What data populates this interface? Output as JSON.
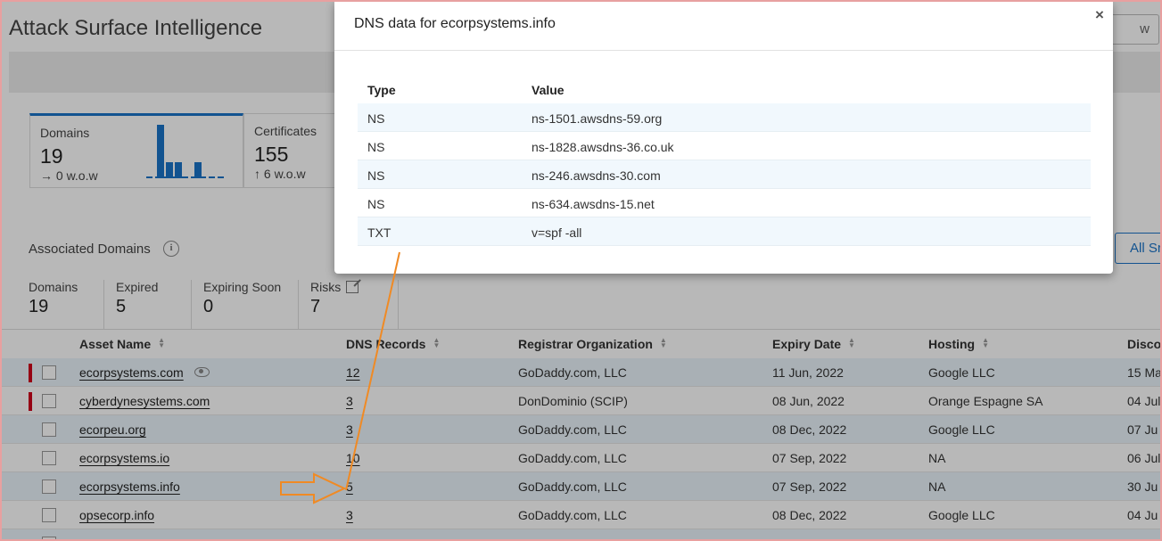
{
  "app": {
    "title": "Attack Surface Intelligence",
    "search_partial": "w"
  },
  "cards": [
    {
      "label": "Domains",
      "value": "19",
      "trend": "→ 0 w.o.w"
    },
    {
      "label": "Certificates",
      "value": "155",
      "trend": "↑ 6 w.o.w"
    }
  ],
  "section": {
    "title": "Associated Domains",
    "info_icon": "i",
    "all_button": "All Sr"
  },
  "summary": [
    {
      "label": "Domains",
      "value": "19"
    },
    {
      "label": "Expired",
      "value": "5"
    },
    {
      "label": "Expiring Soon",
      "value": "0"
    },
    {
      "label": "Risks",
      "value": "7"
    }
  ],
  "table": {
    "headers": [
      "Asset Name",
      "DNS Records",
      "Registrar Organization",
      "Expiry Date",
      "Hosting",
      "Disco"
    ],
    "rows": [
      {
        "name": "ecorpsystems.com",
        "dns": "12",
        "registrar": "GoDaddy.com, LLC",
        "expiry": "11 Jun, 2022",
        "hosting": "Google LLC",
        "disc": "15 Ma",
        "risk": true,
        "watch": true
      },
      {
        "name": "cyberdynesystems.com",
        "dns": "3",
        "registrar": "DonDominio (SCIP)",
        "expiry": "08 Jun, 2022",
        "hosting": "Orange Espagne SA",
        "disc": "04 Jul",
        "risk": true,
        "watch": false
      },
      {
        "name": "ecorpeu.org",
        "dns": "3",
        "registrar": "GoDaddy.com, LLC",
        "expiry": "08 Dec, 2022",
        "hosting": "Google LLC",
        "disc": "07 Ju",
        "risk": false,
        "watch": false
      },
      {
        "name": "ecorpsystems.io",
        "dns": "10",
        "registrar": "GoDaddy.com, LLC",
        "expiry": "07 Sep, 2022",
        "hosting": "NA",
        "disc": "06 Jul",
        "risk": false,
        "watch": false
      },
      {
        "name": "ecorpsystems.info",
        "dns": "5",
        "registrar": "GoDaddy.com, LLC",
        "expiry": "07 Sep, 2022",
        "hosting": "NA",
        "disc": "30 Ju",
        "risk": false,
        "watch": false
      },
      {
        "name": "opsecorp.info",
        "dns": "3",
        "registrar": "GoDaddy.com, LLC",
        "expiry": "08 Dec, 2022",
        "hosting": "Google LLC",
        "disc": "04 Ju",
        "risk": false,
        "watch": false
      }
    ]
  },
  "modal": {
    "title": "DNS data for ecorpsystems.info",
    "close": "×",
    "headers": {
      "type": "Type",
      "value": "Value"
    },
    "records": [
      {
        "type": "NS",
        "value": "ns-1501.awsdns-59.org"
      },
      {
        "type": "NS",
        "value": "ns-1828.awsdns-36.co.uk"
      },
      {
        "type": "NS",
        "value": "ns-246.awsdns-30.com"
      },
      {
        "type": "NS",
        "value": "ns-634.awsdns-15.net"
      },
      {
        "type": "TXT",
        "value": "v=spf -all"
      }
    ]
  },
  "colors": {
    "accent": "#1a73c8",
    "risk": "#d0021b",
    "annotation": "#f08a24"
  }
}
